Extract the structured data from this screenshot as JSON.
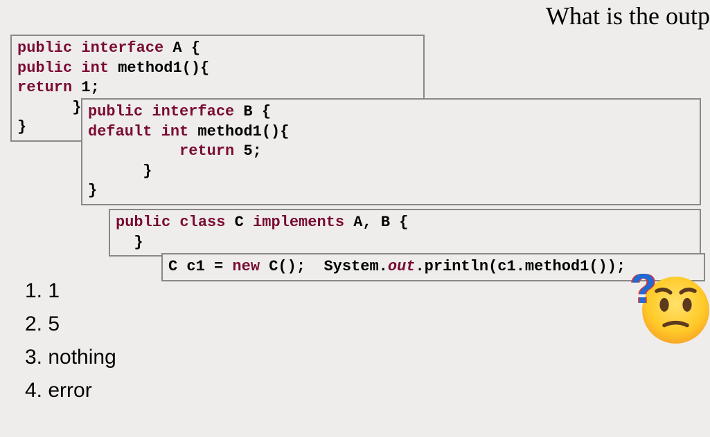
{
  "question_title": "What is the outp",
  "code_a": {
    "l1_kw": "public interface",
    "l1_rest": " A {",
    "l2_kw": "public int",
    "l2_rest": " method1(){",
    "l3_kw": "return ",
    "l3_rest": "1;",
    "l4": "      }",
    "l5": "}"
  },
  "code_b": {
    "l1_kw": "public interface",
    "l1_rest": " B {",
    "l2_kw": "default int",
    "l2_rest": " method1(){",
    "l3_pad": "          ",
    "l3_kw": "return ",
    "l3_rest": "5;",
    "l4": "      }",
    "l5": "}"
  },
  "code_c": {
    "l1_kw": "public class",
    "l1_mid": " C ",
    "l1_kw2": "implements",
    "l1_rest": " A, B {",
    "l2": "  }"
  },
  "code_d": {
    "l1_a": "C c1 = ",
    "l1_new": "new ",
    "l1_b": "C();  System.",
    "l1_out": "out",
    "l1_c": ".println(c1.method1());"
  },
  "options": {
    "o1": "1. 1",
    "o2": "2. 5",
    "o3": "3. nothing",
    "o4": "4. error"
  },
  "qmark": "?"
}
